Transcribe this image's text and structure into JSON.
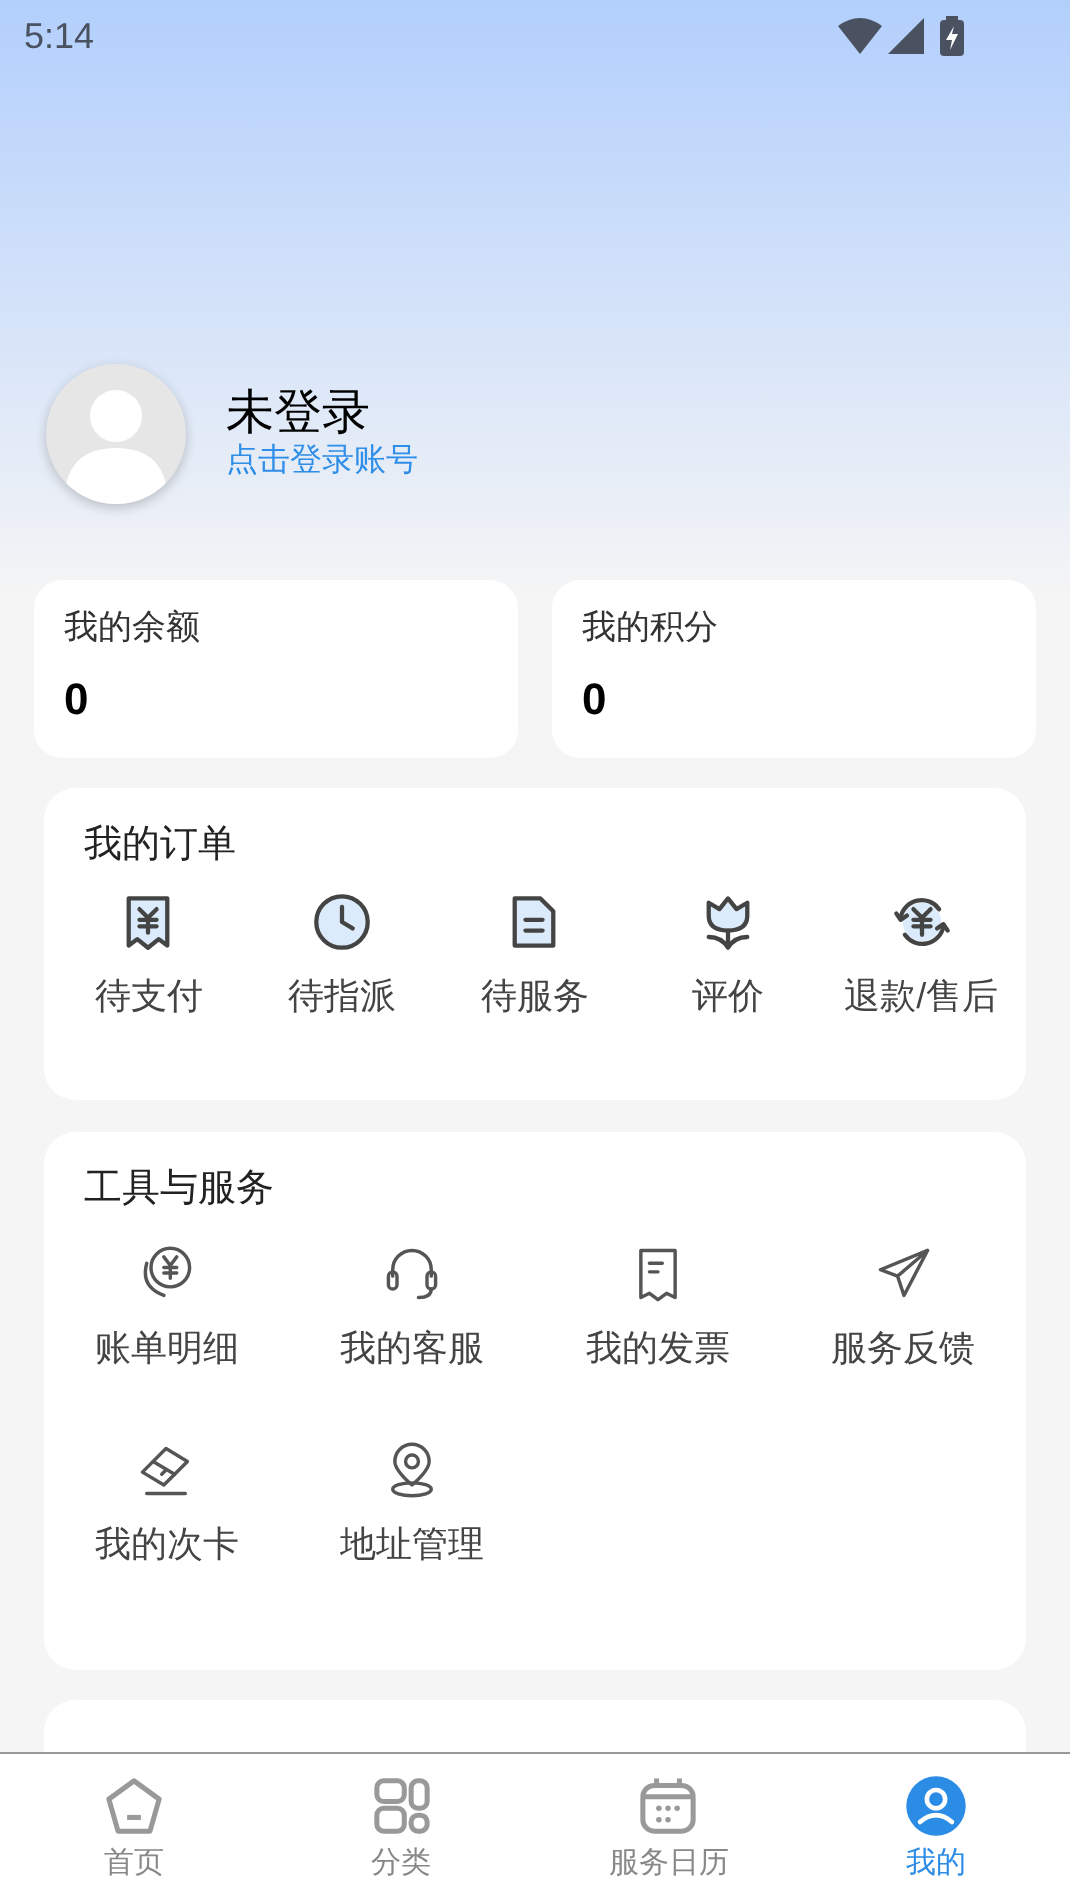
{
  "status_bar": {
    "time": "5:14"
  },
  "profile": {
    "name": "未登录",
    "login_link": "点击登录账号"
  },
  "balances": [
    {
      "label": "我的余额",
      "value": "0"
    },
    {
      "label": "我的积分",
      "value": "0"
    }
  ],
  "orders": {
    "title": "我的订单",
    "items": [
      "待支付",
      "待指派",
      "待服务",
      "评价",
      "退款/售后"
    ]
  },
  "tools": {
    "title": "工具与服务",
    "items": [
      "账单明细",
      "我的客服",
      "我的发票",
      "服务反馈",
      "我的次卡",
      "地址管理"
    ]
  },
  "about": {
    "kind": "card"
  },
  "tabs": [
    {
      "label": "首页",
      "selected": false
    },
    {
      "label": "分类",
      "selected": false
    },
    {
      "label": "服务日历",
      "selected": false
    },
    {
      "label": "我的",
      "selected": true
    }
  ]
}
